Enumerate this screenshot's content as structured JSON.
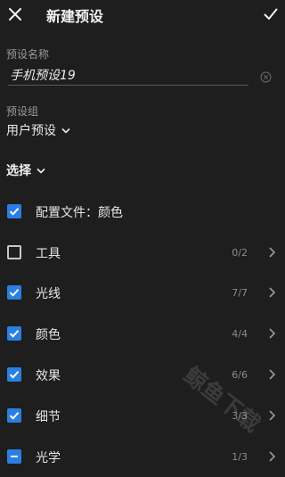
{
  "header": {
    "title": "新建预设"
  },
  "name_field": {
    "label": "预设名称",
    "value": "手机预设19"
  },
  "group_field": {
    "label": "预设组",
    "value": "用户预设"
  },
  "select_label": "选择",
  "items": [
    {
      "label": "配置文件：颜色",
      "count": "",
      "state": "checked",
      "has_chevron": false
    },
    {
      "label": "工具",
      "count": "0/2",
      "state": "unchecked",
      "has_chevron": true
    },
    {
      "label": "光线",
      "count": "7/7",
      "state": "checked",
      "has_chevron": true
    },
    {
      "label": "颜色",
      "count": "4/4",
      "state": "checked",
      "has_chevron": true
    },
    {
      "label": "效果",
      "count": "6/6",
      "state": "checked",
      "has_chevron": true
    },
    {
      "label": "细节",
      "count": "3/3",
      "state": "checked",
      "has_chevron": true
    },
    {
      "label": "光学",
      "count": "1/3",
      "state": "partial",
      "has_chevron": true
    }
  ],
  "watermark": "鲸鱼下载",
  "colors": {
    "background": "#1e1e1e",
    "accent": "#2b7fe0"
  }
}
